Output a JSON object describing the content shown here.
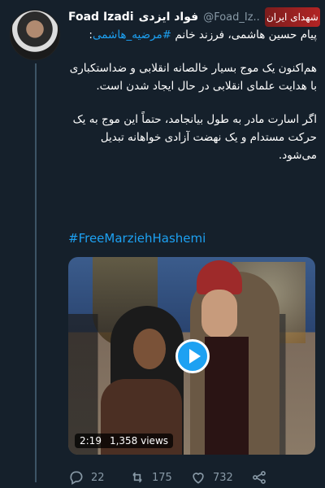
{
  "tweet": {
    "author_name": "Foad Izadi",
    "author_name_fa": "فواد ایزدی",
    "handle": "@Foad_Iz..",
    "logo_text": "شهدای ایران",
    "paragraph_1_text": "پیام حسین هاشمی، فرزند خانم ",
    "paragraph_1_hashtag": "#مرضیه_هاشمی",
    "paragraph_1_end": ":",
    "paragraph_2": "هم‌اکنون یک موج بسیار خالصانه انقلابی و ضداستکباری با هدایت علمای انقلابی در حال ایجاد شدن است.",
    "paragraph_3": "اگر اسارت مادر به طول بیانجامد، حتماً این موج به یک حرکت مستدام و یک نهضت آزادی خواهانه تبدیل می‌شود.",
    "english_hashtag": "#FreeMarziehHashemi"
  },
  "media": {
    "duration": "2:19",
    "views": "1,358 views"
  },
  "actions": {
    "replies": "22",
    "retweets": "175",
    "likes": "732"
  },
  "icons": {
    "reply": "comment-bubble-icon",
    "retweet": "retweet-arrows-icon",
    "like": "heart-icon",
    "share": "share-icon"
  },
  "colors": {
    "background": "#15202b",
    "accent": "#1da1f2",
    "muted": "#8899a6"
  }
}
